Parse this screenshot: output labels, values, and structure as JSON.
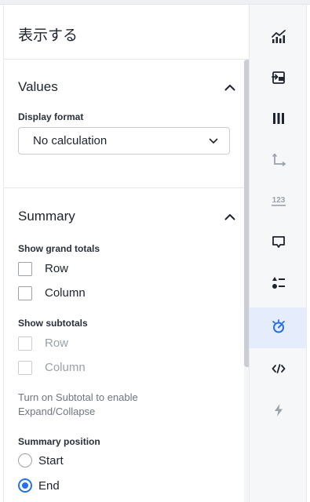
{
  "panel": {
    "title": "表示する"
  },
  "values_section": {
    "title": "Values",
    "display_format_label": "Display format",
    "display_format_value": "No calculation"
  },
  "summary_section": {
    "title": "Summary",
    "grand_totals_label": "Show grand totals",
    "grand_totals": [
      {
        "label": "Row",
        "checked": false,
        "disabled": false
      },
      {
        "label": "Column",
        "checked": false,
        "disabled": false
      }
    ],
    "subtotals_label": "Show subtotals",
    "subtotals": [
      {
        "label": "Row",
        "checked": false,
        "disabled": true
      },
      {
        "label": "Column",
        "checked": false,
        "disabled": true
      }
    ],
    "subtotal_hint": "Turn on Subtotal to enable Expand/Collapse",
    "position_label": "Summary position",
    "positions": [
      {
        "label": "Start",
        "selected": false
      },
      {
        "label": "End",
        "selected": true
      }
    ]
  },
  "rail": {
    "items": [
      {
        "icon": "chart-bar-line-icon",
        "active": false,
        "disabled": false
      },
      {
        "icon": "swap-fields-icon",
        "active": false,
        "disabled": false
      },
      {
        "icon": "columns-icon",
        "active": false,
        "disabled": false
      },
      {
        "icon": "axis-icon",
        "active": false,
        "disabled": true
      },
      {
        "icon": "number-format-icon",
        "active": false,
        "disabled": true
      },
      {
        "icon": "tooltip-icon",
        "active": false,
        "disabled": false
      },
      {
        "icon": "conditional-format-icon",
        "active": false,
        "disabled": false
      },
      {
        "icon": "settings-gauge-icon",
        "active": true,
        "disabled": false
      },
      {
        "icon": "code-icon",
        "active": false,
        "disabled": false
      },
      {
        "icon": "lightning-icon",
        "active": false,
        "disabled": true
      }
    ]
  },
  "colors": {
    "accent": "#2770ef",
    "icon": "#1d232f",
    "icon_disabled": "#9aa1ab",
    "active_bg": "#e5edfd"
  }
}
